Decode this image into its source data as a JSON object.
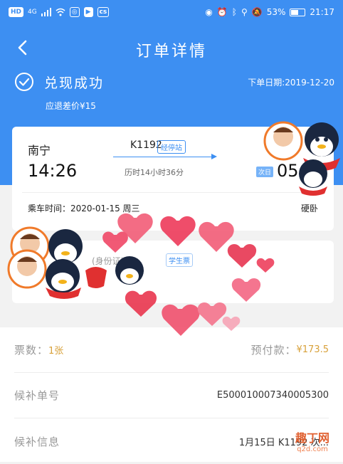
{
  "status_bar": {
    "hd": "HD",
    "network": "4G",
    "battery": "53%",
    "time": "21:17",
    "icons": [
      "signal-icon",
      "wifi-icon",
      "app-icon",
      "eye-icon",
      "alarm-icon",
      "bluetooth-icon",
      "location-icon",
      "mute-icon",
      "battery-icon"
    ]
  },
  "nav": {
    "title": "订单详情",
    "back_icon": "chevron-left-icon"
  },
  "order_status": {
    "icon": "check-circle-icon",
    "text": "兑现成功",
    "order_date": "下单日期:2019-12-20",
    "refund": "应退差价¥15"
  },
  "trip": {
    "departure_city": "南宁",
    "departure_time": "14:26",
    "train_no": "K1192",
    "train_badge": "经停站",
    "duration": "历时14小时36分",
    "arrival_badge": "次日",
    "arrival_time": "05:",
    "ride_time": "乘车时间：2020-01-15 周三",
    "seat_type": "硬卧"
  },
  "passenger": {
    "line": "(身份证)",
    "tag": "学生票"
  },
  "info": {
    "ticket_count_label": "票数：",
    "ticket_count_value": "1张",
    "prepay_label": "预付款：",
    "prepay_value": "¥173.5",
    "order_no_label": "候补单号",
    "order_no_value": "E500010007340005300",
    "info_label": "候补信息",
    "info_value": "1月15日 K1192 次..."
  },
  "colors": {
    "brand": "#3d8ff2",
    "accent_gold": "#d8a13a",
    "background": "#f2f2f2"
  },
  "watermark": {
    "text": "趣丁网",
    "sub": "q2d.com"
  }
}
